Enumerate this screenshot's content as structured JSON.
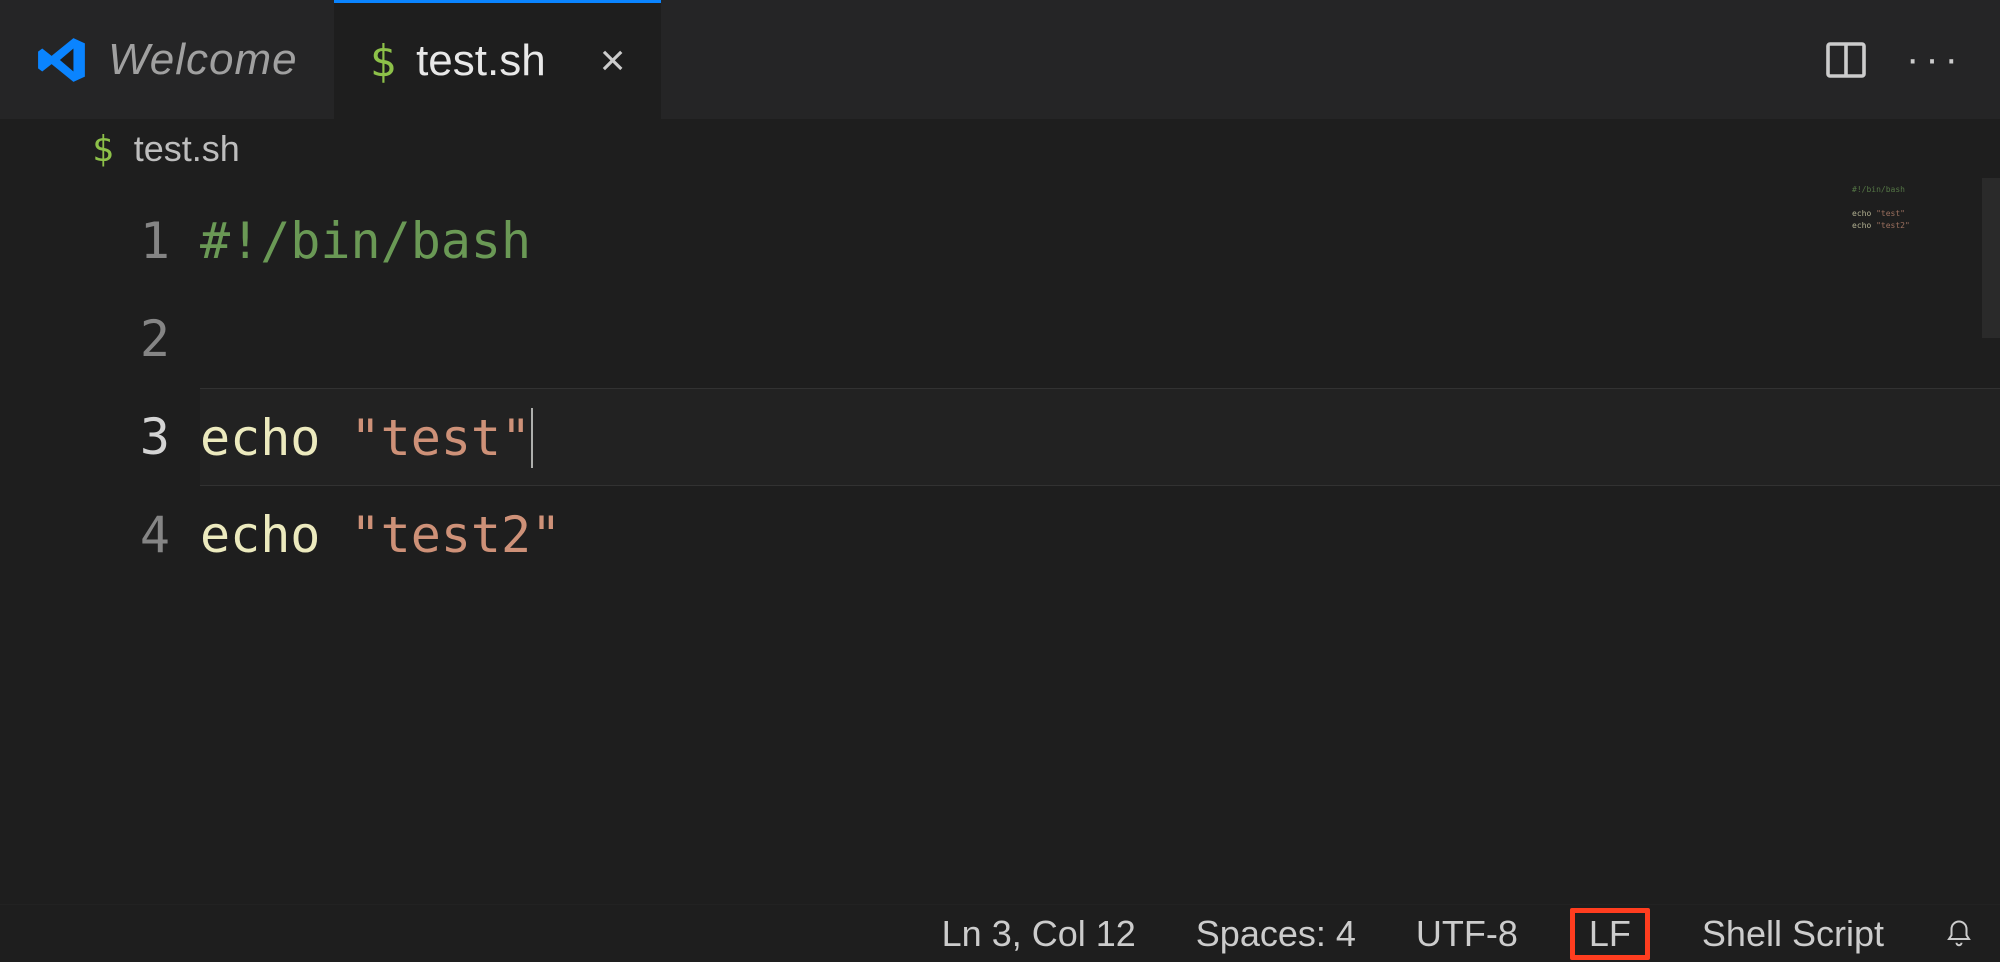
{
  "tabs": {
    "welcome": {
      "label": "Welcome"
    },
    "active": {
      "icon": "dollar",
      "label": "test.sh",
      "close": "×"
    }
  },
  "breadcrumb": {
    "icon": "dollar",
    "name": "test.sh"
  },
  "editor": {
    "lines": [
      {
        "num": "1",
        "tokens": [
          {
            "cls": "tok-comment",
            "text": "#!/bin/bash"
          }
        ],
        "current": false
      },
      {
        "num": "2",
        "tokens": [],
        "current": false
      },
      {
        "num": "3",
        "tokens": [
          {
            "cls": "tok-builtin",
            "text": "echo "
          },
          {
            "cls": "tok-string",
            "text": "\"test\""
          }
        ],
        "current": true
      },
      {
        "num": "4",
        "tokens": [
          {
            "cls": "tok-builtin",
            "text": "echo "
          },
          {
            "cls": "tok-string",
            "text": "\"test2\""
          }
        ],
        "current": false
      }
    ]
  },
  "minimap": {
    "l1": "#!/bin/bash",
    "l3a": "echo ",
    "l3b": "\"test\"",
    "l4a": "echo ",
    "l4b": "\"test2\""
  },
  "statusbar": {
    "position": "Ln 3, Col 12",
    "indent": "Spaces: 4",
    "encoding": "UTF-8",
    "eol": "LF",
    "language": "Shell Script"
  },
  "icons": {
    "dollar_glyph": "$"
  }
}
